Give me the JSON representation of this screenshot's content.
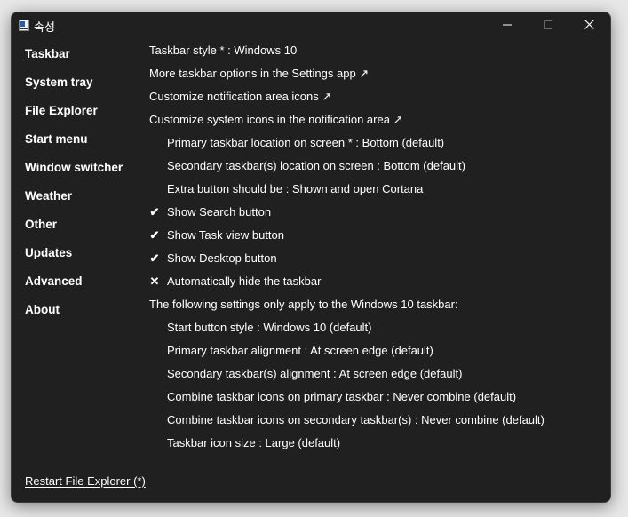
{
  "window": {
    "title": "속성",
    "minimize_glyph": "–",
    "maximize_glyph": "☐",
    "close_glyph": "✕"
  },
  "sidebar": {
    "items": [
      {
        "label": "Taskbar",
        "active": true
      },
      {
        "label": "System tray"
      },
      {
        "label": "File Explorer"
      },
      {
        "label": "Start menu"
      },
      {
        "label": "Window switcher"
      },
      {
        "label": "Weather"
      },
      {
        "label": "Other"
      },
      {
        "label": "Updates"
      },
      {
        "label": "Advanced"
      },
      {
        "label": "About"
      }
    ]
  },
  "content": {
    "rows": [
      {
        "text": "Taskbar style * : Windows 10"
      },
      {
        "text": "More taskbar options in the Settings app ↗"
      },
      {
        "text": "Customize notification area icons ↗"
      },
      {
        "text": "Customize system icons in the notification area ↗"
      },
      {
        "text": "Primary taskbar location on screen * : Bottom (default)"
      },
      {
        "text": "Secondary taskbar(s) location on screen : Bottom (default)"
      },
      {
        "text": "Extra button should be : Shown and open Cortana"
      },
      {
        "text": "Show Search button",
        "mark": "✔",
        "checked": true
      },
      {
        "text": "Show Task view button",
        "mark": "✔",
        "checked": true
      },
      {
        "text": "Show Desktop button",
        "mark": "✔",
        "checked": true
      },
      {
        "text": "Automatically hide the taskbar",
        "mark": "✕",
        "checked": false
      },
      {
        "text": "The following settings only apply to the Windows 10 taskbar:"
      },
      {
        "text": "Start button style : Windows 10 (default)"
      },
      {
        "text": "Primary taskbar alignment : At screen edge (default)"
      },
      {
        "text": "Secondary taskbar(s) alignment : At screen edge (default)"
      },
      {
        "text": "Combine taskbar icons on primary taskbar : Never combine (default)"
      },
      {
        "text": "Combine taskbar icons on secondary taskbar(s) : Never combine (default)"
      },
      {
        "text": "Taskbar icon size : Large (default)"
      }
    ]
  },
  "footer": {
    "restart_label": "Restart File Explorer (*)"
  },
  "colors": {
    "window_bg": "#202020",
    "text": "#ffffff",
    "desktop_bg": "#e7e7e7"
  }
}
